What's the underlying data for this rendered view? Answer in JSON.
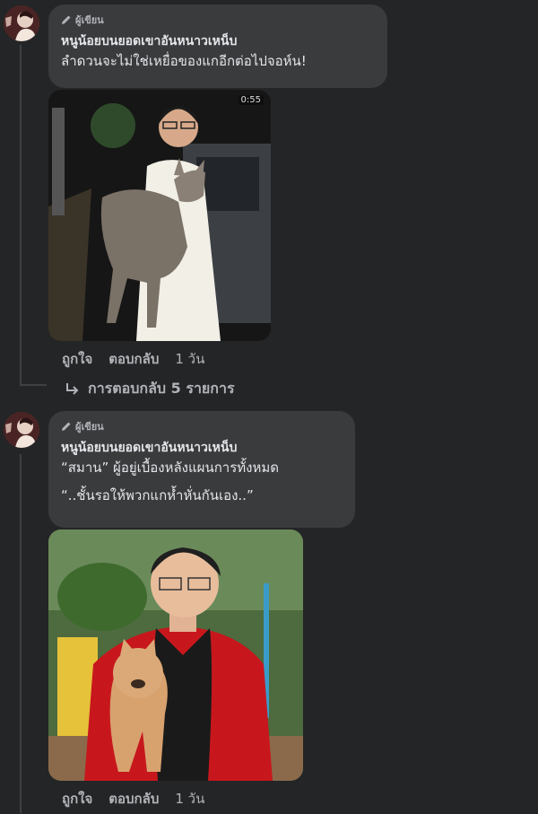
{
  "comments": [
    {
      "author_badge": "ผู้เขียน",
      "name": "หนูน้อยบนยอดเขาอันหนาวเหน็บ",
      "lines": [
        "ลำดวนจะไม่ใช่เหยื่อของแกอีกต่อไปจอห์น!"
      ],
      "media": {
        "type": "video",
        "duration": "0:55",
        "description_icon": "video-thumbnail"
      },
      "actions": {
        "like": "ถูกใจ",
        "reply": "ตอบกลับ",
        "time": "1 วัน"
      },
      "replies_label": "การตอบกลับ 5 รายการ"
    },
    {
      "author_badge": "ผู้เขียน",
      "name": "หนูน้อยบนยอดเขาอันหนาวเหน็บ",
      "lines": [
        "“สมาน” ผู้อยู่เบื้องหลังแผนการทั้งหมด",
        "“..ชั้นรอให้พวกแกห้ำหั่นกันเอง..”"
      ],
      "media": {
        "type": "image",
        "description_icon": "photo-thumbnail"
      },
      "actions": {
        "like": "ถูกใจ",
        "reply": "ตอบกลับ",
        "time": "1 วัน"
      }
    }
  ],
  "colors": {
    "background": "#242526",
    "bubble": "#3a3b3c",
    "primary_text": "#e4e6eb",
    "secondary_text": "#b0b3b8"
  }
}
